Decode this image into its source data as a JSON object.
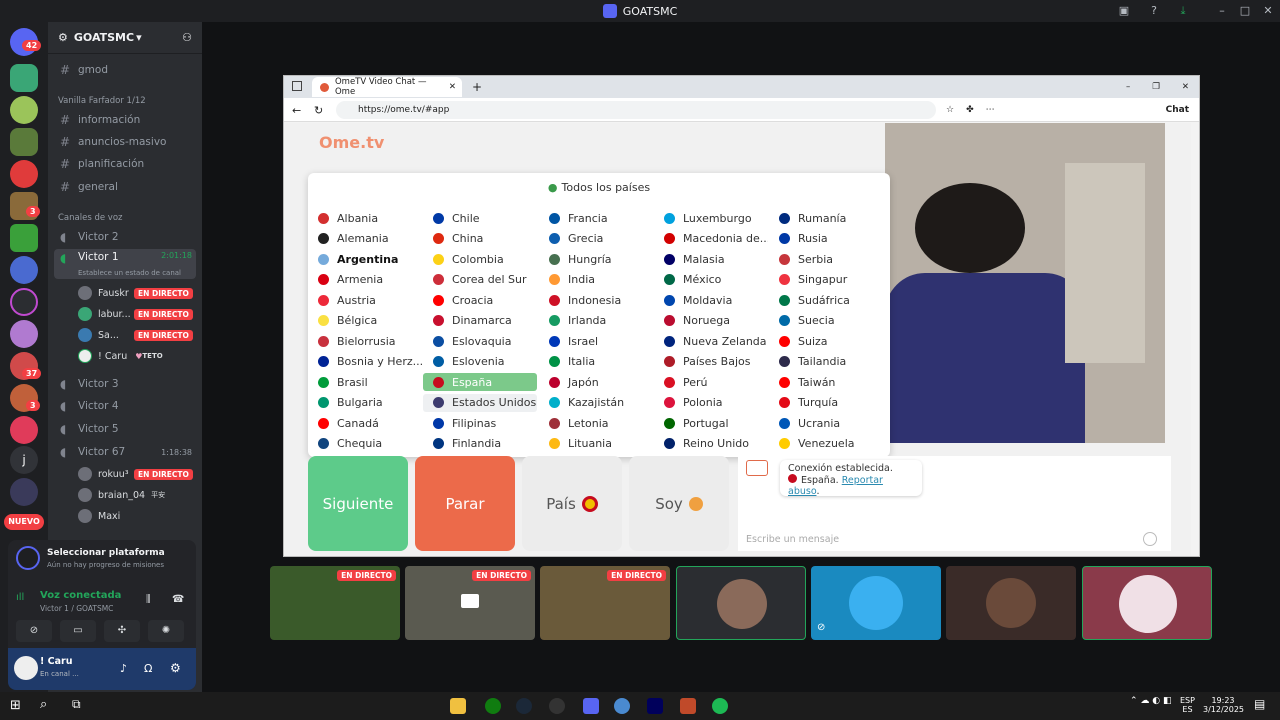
{
  "window": {
    "title": "GOATSMC"
  },
  "rail": {
    "badges": [
      "42",
      "3",
      "37",
      "3"
    ],
    "nuevo": "NUEVO",
    "letter": "j"
  },
  "sidebar": {
    "server_name": "GOATSMC",
    "channel_gmod": "gmod",
    "category1": "Vanilla Farfador 1/12",
    "text_channels": [
      "información",
      "anuncios-masivo",
      "planificación",
      "general"
    ],
    "voice_category": "Canales de voz",
    "voice_channels": [
      "Victor 2",
      "Victor 1",
      "Victor 3",
      "Victor 4",
      "Victor 5",
      "Victor 67"
    ],
    "victor1_time": "2:01:18",
    "victor1_status": "Establece un estado de canal",
    "victor67_time": "1:18:38",
    "users_v1": [
      "Fauskr",
      "labur...",
      "Sa...",
      "! Caru"
    ],
    "caru_tag": "TETO",
    "users_v67": [
      "rokuu³",
      "braian_04",
      "Maxi"
    ],
    "braian_tag": "平安",
    "live_label": "EN DIRECTO",
    "platform_title": "Seleccionar plataforma",
    "platform_sub": "Aún no hay progreso de misiones",
    "voice_status": "Voz conectada",
    "voice_where": "Victor 1 / GOATSMC",
    "user_name": "! Caru",
    "user_status": "En canal ..."
  },
  "browser": {
    "tab_title": "OmeTV Video Chat — Ome",
    "url": "https://ome.tv/#app",
    "chat_btn": "Chat"
  },
  "ometv": {
    "logo": "Ome.tv",
    "all_countries": "Todos los países",
    "countries": [
      [
        "Albania",
        "Alemania",
        "Argentina",
        "Armenia",
        "Austria",
        "Bélgica",
        "Bielorrusia",
        "Bosnia y Herz...",
        "Brasil",
        "Bulgaria",
        "Canadá",
        "Chequia"
      ],
      [
        "Chile",
        "China",
        "Colombia",
        "Corea del Sur",
        "Croacia",
        "Dinamarca",
        "Eslovaquia",
        "Eslovenia",
        "España",
        "Estados Unidos",
        "Filipinas",
        "Finlandia"
      ],
      [
        "Francia",
        "Grecia",
        "Hungría",
        "India",
        "Indonesia",
        "Irlanda",
        "Israel",
        "Italia",
        "Japón",
        "Kazajistán",
        "Letonia",
        "Lituania"
      ],
      [
        "Luxemburgo",
        "Macedonia de...",
        "Malasia",
        "México",
        "Moldavia",
        "Noruega",
        "Nueva Zelanda",
        "Países Bajos",
        "Perú",
        "Polonia",
        "Portugal",
        "Reino Unido"
      ],
      [
        "Rumanía",
        "Rusia",
        "Serbia",
        "Singapur",
        "Sudáfrica",
        "Suecia",
        "Suiza",
        "Tailandia",
        "Taiwán",
        "Turquía",
        "Ucrania",
        "Venezuela"
      ]
    ],
    "flag_colors": [
      [
        "#d32f2f",
        "#222222",
        "#75aadb",
        "#d90012",
        "#ed2939",
        "#fae042",
        "#c8313e",
        "#002395",
        "#009c3b",
        "#00966e",
        "#ff0000",
        "#11457e"
      ],
      [
        "#0039a6",
        "#de2910",
        "#fcd116",
        "#cd2e3a",
        "#ff0000",
        "#c8102e",
        "#0b4ea2",
        "#005da4",
        "#c60b1e",
        "#3c3b6e",
        "#0038a8",
        "#003580"
      ],
      [
        "#0055a4",
        "#0d5eaf",
        "#477050",
        "#ff9933",
        "#ce1126",
        "#169b62",
        "#0038b8",
        "#009246",
        "#bc002d",
        "#00afca",
        "#9e3039",
        "#fdb913"
      ],
      [
        "#00a1de",
        "#d20000",
        "#010066",
        "#006847",
        "#0046ae",
        "#ba0c2f",
        "#00247d",
        "#ae1c28",
        "#d91023",
        "#dc143c",
        "#006600",
        "#012169"
      ],
      [
        "#002b7f",
        "#0039a6",
        "#c6363c",
        "#ef3340",
        "#007749",
        "#006aa7",
        "#ff0000",
        "#2d2a4a",
        "#fe0000",
        "#e30a17",
        "#0057b7",
        "#ffcc00"
      ]
    ],
    "btn_next": "Siguiente",
    "btn_stop": "Parar",
    "btn_country": "País",
    "btn_gender": "Soy",
    "msg_conn": "Conexión establecida.",
    "msg_country": "España.",
    "msg_report": "Reportar abuso",
    "msg_placeholder": "Escribe un mensaje"
  },
  "streams": {
    "live_label": "EN DIRECTO"
  },
  "taskbar": {
    "lang1": "ESP",
    "lang2": "ES",
    "time": "19:23",
    "date": "3/12/2025"
  }
}
